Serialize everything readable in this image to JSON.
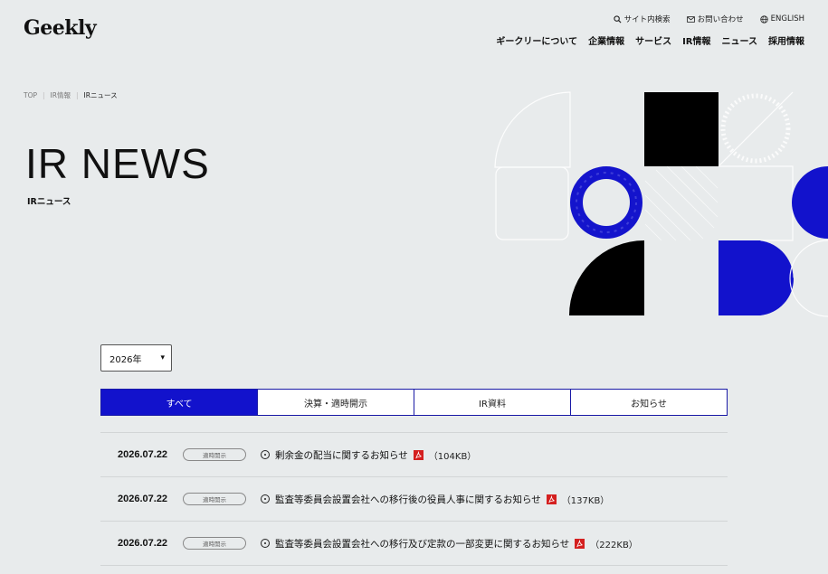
{
  "header": {
    "logo": "Geekly",
    "utility": [
      {
        "label": "サイト内検索",
        "icon": "search-icon"
      },
      {
        "label": "お問い合わせ",
        "icon": "mail-icon"
      },
      {
        "label": "ENGLISH",
        "icon": "globe-icon"
      }
    ],
    "nav": [
      "ギークリーについて",
      "企業情報",
      "サービス",
      "IR情報",
      "ニュース",
      "採用情報"
    ]
  },
  "breadcrumb": [
    "TOP",
    "IR情報",
    "IRニュース"
  ],
  "hero": {
    "title": "IR NEWS",
    "subtitle": "IRニュース"
  },
  "filter": {
    "year": "2026年"
  },
  "tabs": [
    "すべて",
    "決算・適時開示",
    "IR資料",
    "お知らせ"
  ],
  "active_tab": 0,
  "news": [
    {
      "date": "2026.07.22",
      "badge": "適時開示",
      "title": "剰余金の配当に関するお知らせ",
      "size": "（104KB）"
    },
    {
      "date": "2026.07.22",
      "badge": "適時開示",
      "title": "監査等委員会設置会社への移行後の役員人事に関するお知らせ",
      "size": "（137KB）"
    },
    {
      "date": "2026.07.22",
      "badge": "適時開示",
      "title": "監査等委員会設置会社への移行及び定款の一部変更に関するお知らせ",
      "size": "（222KB）"
    }
  ],
  "colors": {
    "accent": "#1212cc",
    "background": "#e8ebec",
    "pdf": "#d42020"
  }
}
